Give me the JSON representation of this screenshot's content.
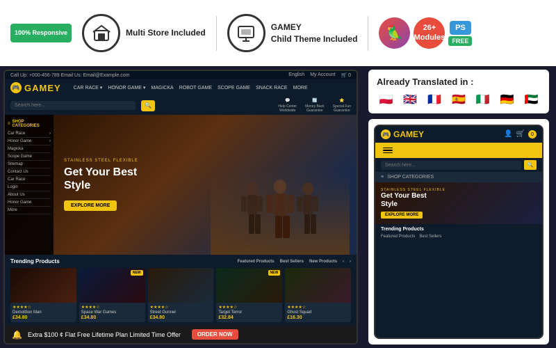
{
  "badges": {
    "responsive": "100%\nResponsive",
    "multistore_label": "Multi Store\nIncluded",
    "childtheme_label": "Child Theme\nIncluded",
    "modules_count": "26+\nModules",
    "ps_label": "PS",
    "free_label": "FREE"
  },
  "translated": {
    "title": "Already Translated in :"
  },
  "store": {
    "name": "GAMEY",
    "topbar_phone": "Call Up: +000-456-789  Email Us: Email@Example.com",
    "topbar_lang": "English",
    "topbar_account": "My Account",
    "nav_links": [
      "CAR RACE",
      "HONOR GAME",
      "MAGICKA",
      "ROBOT GAME",
      "SCOPE GAME",
      "SNACK RACE",
      "MORE"
    ],
    "cart_label": "0",
    "search_placeholder": "Search here...",
    "support_items": [
      "Help Center Worldwide",
      "Money Back Guarantee",
      "Special Fun Guarantee"
    ],
    "hero_subtitle": "STAINLESS STEEL FLEXIBLE",
    "hero_title": "Get Your Best\nStyle",
    "hero_btn": "EXPLORE MORE",
    "trending_title": "Trending Products",
    "trending_tabs": [
      "Featured Products",
      "Best Sellers",
      "New Products"
    ],
    "products": [
      {
        "name": "Demolition Man",
        "price": "£34.80",
        "stars": "★★★★☆"
      },
      {
        "name": "Space War Games",
        "price": "£34.80",
        "stars": "★★★★☆"
      },
      {
        "name": "Street Gunner",
        "price": "£34.80",
        "stars": "★★★★☆"
      },
      {
        "name": "Target Terror",
        "price": "£32.84",
        "stars": "★★★★☆"
      },
      {
        "name": "Ghost Squad",
        "price": "£16.30",
        "stars": "★★★★☆"
      }
    ]
  },
  "mobile": {
    "name": "GAMEY",
    "search_placeholder": "Search here...",
    "categories_label": "SHOP CATEGORIES",
    "hero_subtitle": "STAINLESS STEEL FLEXIBLE",
    "hero_title": "Get Your Best\nStyle",
    "hero_btn": "EXPLORE MORE",
    "trending_title": "Trending Products",
    "trending_tabs": [
      "Featured Products",
      "Best Sellers"
    ]
  },
  "offer": {
    "text": "Extra $100 ¢ Flat Free Lifetime Plan Limited Time Offer",
    "btn_label": "ORDER NOW"
  },
  "flags": [
    "🇵🇱",
    "🇬🇧",
    "🇫🇷",
    "🇪🇸",
    "🇮🇹",
    "🇩🇪",
    "🇦🇪"
  ]
}
